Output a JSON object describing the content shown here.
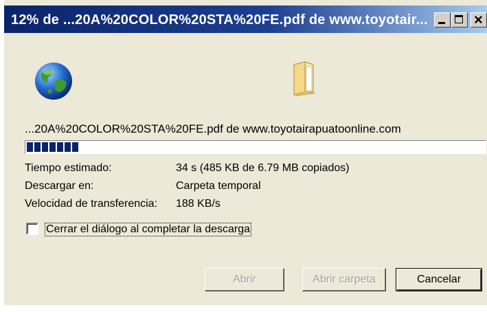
{
  "window": {
    "title": "12% de ...20A%20COLOR%20STA%20FE.pdf de www.toyotair...",
    "minimize_icon": "minimize-icon",
    "maximize_icon": "maximize-icon",
    "close_icon": "close-icon"
  },
  "icons": {
    "source": "globe-icon",
    "destination": "folder-icon"
  },
  "download": {
    "file_line": "...20A%20COLOR%20STA%20FE.pdf de www.toyotairapuatoonline.com",
    "progress_percent": 12
  },
  "info": [
    {
      "label": "Tiempo estimado:",
      "value": "34 s (485 KB de 6.79 MB copiados)"
    },
    {
      "label": "Descargar en:",
      "value": "Carpeta temporal"
    },
    {
      "label": "Velocidad de transferencia:",
      "value": "188 KB/s"
    }
  ],
  "close_on_complete": {
    "label": "Cerrar el diálogo al completar la descarga",
    "checked": false
  },
  "buttons": {
    "open": "Abrir",
    "open_folder": "Abrir carpeta",
    "cancel": "Cancelar"
  },
  "colors": {
    "title_bar_start": "#0a246a",
    "title_bar_end": "#a6caf0",
    "progress_fill": "#0a246a",
    "dialog_background": "#ece9d8"
  }
}
